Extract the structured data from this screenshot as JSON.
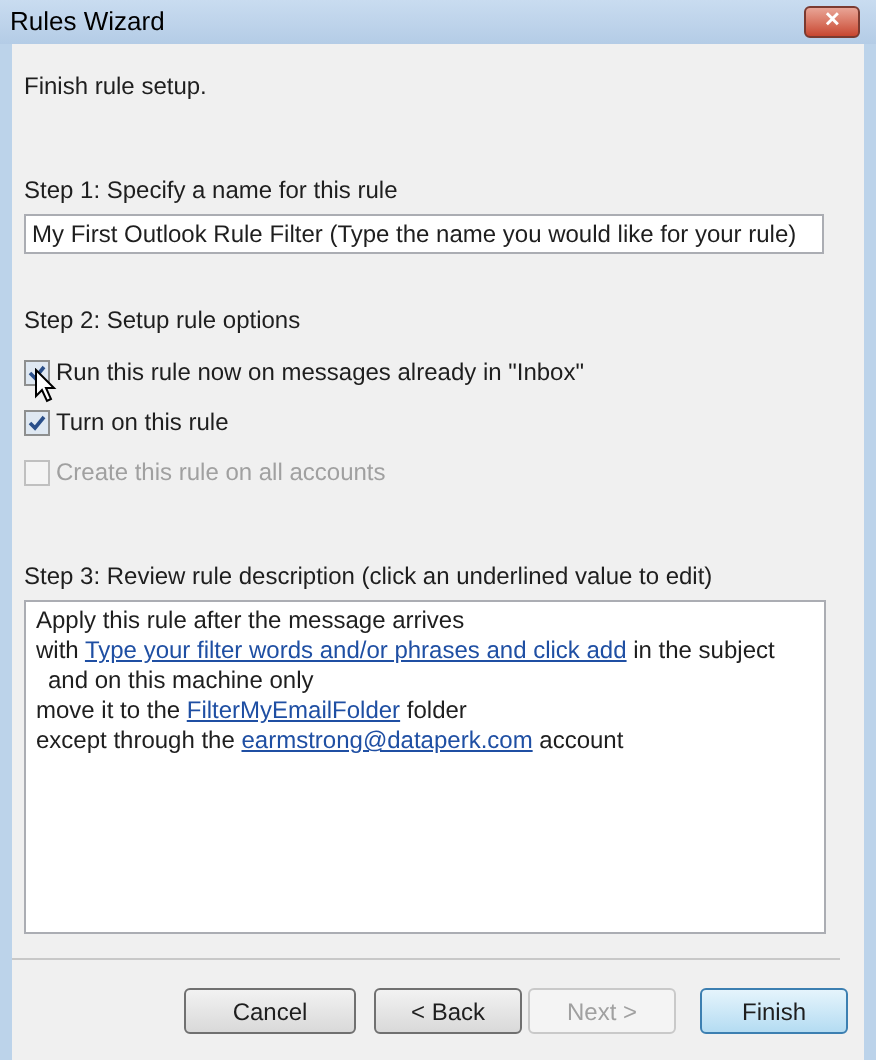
{
  "window": {
    "title": "Rules Wizard",
    "close_label": "✕"
  },
  "heading": "Finish rule setup.",
  "step1": {
    "label": "Step 1: Specify a name for this rule",
    "value": "My First Outlook Rule Filter (Type the name you would like for your rule)"
  },
  "step2": {
    "label": "Step 2: Setup rule options",
    "options": [
      {
        "label": "Run this rule now on messages already in \"Inbox\"",
        "checked": true,
        "disabled": false
      },
      {
        "label": "Turn on this rule",
        "checked": true,
        "disabled": false
      },
      {
        "label": "Create this rule on all accounts",
        "checked": false,
        "disabled": true
      }
    ]
  },
  "step3": {
    "label": "Step 3: Review rule description (click an underlined value to edit)",
    "lines": [
      {
        "indented": false,
        "parts": [
          {
            "text": "Apply this rule after the message arrives",
            "link": false
          }
        ]
      },
      {
        "indented": false,
        "parts": [
          {
            "text": "with ",
            "link": false
          },
          {
            "text": "Type your filter words and/or phrases and click add",
            "link": true
          },
          {
            "text": " in the subject",
            "link": false
          }
        ]
      },
      {
        "indented": true,
        "parts": [
          {
            "text": "and on this machine only",
            "link": false
          }
        ]
      },
      {
        "indented": false,
        "parts": [
          {
            "text": "move it to the ",
            "link": false
          },
          {
            "text": "FilterMyEmailFolder",
            "link": true
          },
          {
            "text": " folder",
            "link": false
          }
        ]
      },
      {
        "indented": false,
        "parts": [
          {
            "text": "except through the ",
            "link": false
          },
          {
            "text": "earmstrong@dataperk.com",
            "link": true
          },
          {
            "text": " account",
            "link": false
          }
        ]
      }
    ]
  },
  "buttons": [
    {
      "label": "Cancel",
      "disabled": false,
      "default": false
    },
    {
      "label": "< Back",
      "disabled": false,
      "default": false
    },
    {
      "label": "Next >",
      "disabled": true,
      "default": false
    },
    {
      "label": "Finish",
      "disabled": false,
      "default": true
    }
  ]
}
